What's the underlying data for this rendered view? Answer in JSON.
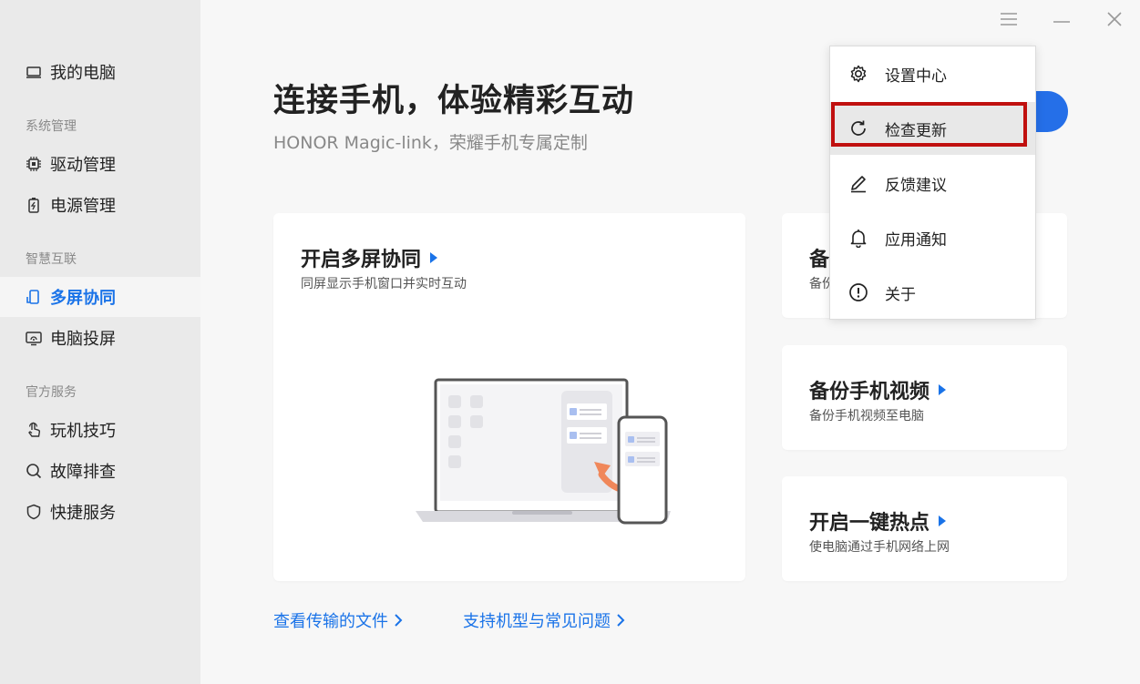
{
  "sidebar": {
    "my_pc": "我的电脑",
    "section_system": "系统管理",
    "driver": "驱动管理",
    "power": "电源管理",
    "section_smart": "智慧互联",
    "multiscreen": "多屏协同",
    "projection": "电脑投屏",
    "section_official": "官方服务",
    "tips": "玩机技巧",
    "troubleshoot": "故障排查",
    "quick_service": "快捷服务"
  },
  "main": {
    "title": "连接手机，体验精彩互动",
    "subtitle": "HONOR Magic-link，荣耀手机专属定制",
    "cards": [
      {
        "title": "开启多屏协同",
        "desc": "同屏显示手机窗口并实时互动"
      },
      {
        "title": "备",
        "desc": "备份"
      },
      {
        "title": "备份手机视频",
        "desc": "备份手机视频至电脑"
      },
      {
        "title": "开启一键热点",
        "desc": "使电脑通过手机网络上网"
      }
    ],
    "link_files": "查看传输的文件",
    "link_faq": "支持机型与常见问题"
  },
  "menu": {
    "settings": "设置中心",
    "check_update": "检查更新",
    "feedback": "反馈建议",
    "notifications": "应用通知",
    "about": "关于"
  },
  "colors": {
    "accent": "#1a73e8",
    "highlight_border": "#c0100f",
    "sidebar_bg": "#eaeaea"
  }
}
